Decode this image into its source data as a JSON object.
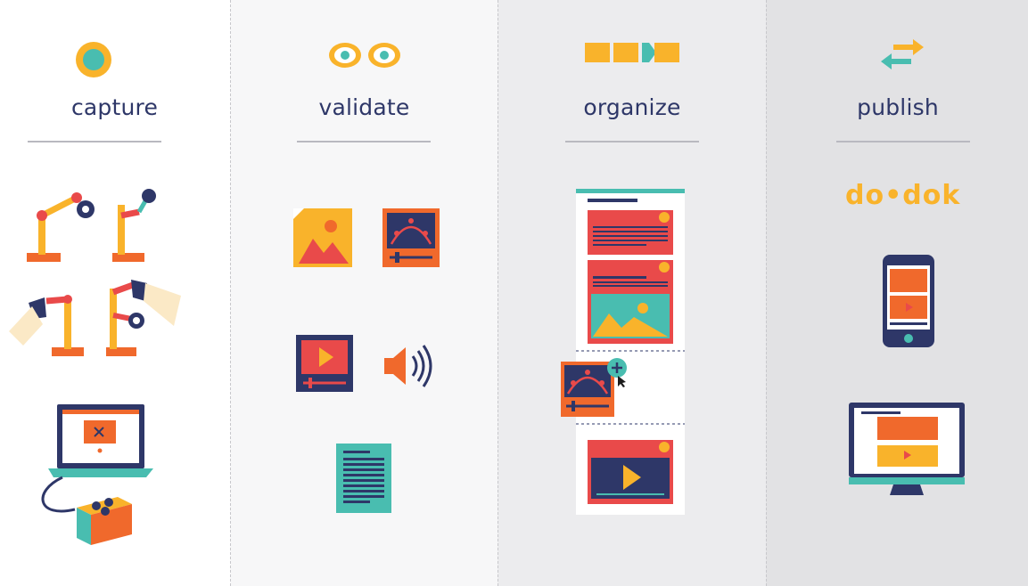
{
  "steps": [
    {
      "label": "capture",
      "icon": "circle-icon"
    },
    {
      "label": "validate",
      "icon": "eyes-icon"
    },
    {
      "label": "organize",
      "icon": "blocks-icon"
    },
    {
      "label": "publish",
      "icon": "arrows-icon"
    }
  ],
  "publish": {
    "logo_text": "do•dok"
  },
  "colors": {
    "navy": "#2e3768",
    "orange": "#f0692c",
    "yellow": "#f9b32b",
    "red": "#e94a4a",
    "teal": "#49bdb0",
    "cream": "#fbe9c6"
  }
}
